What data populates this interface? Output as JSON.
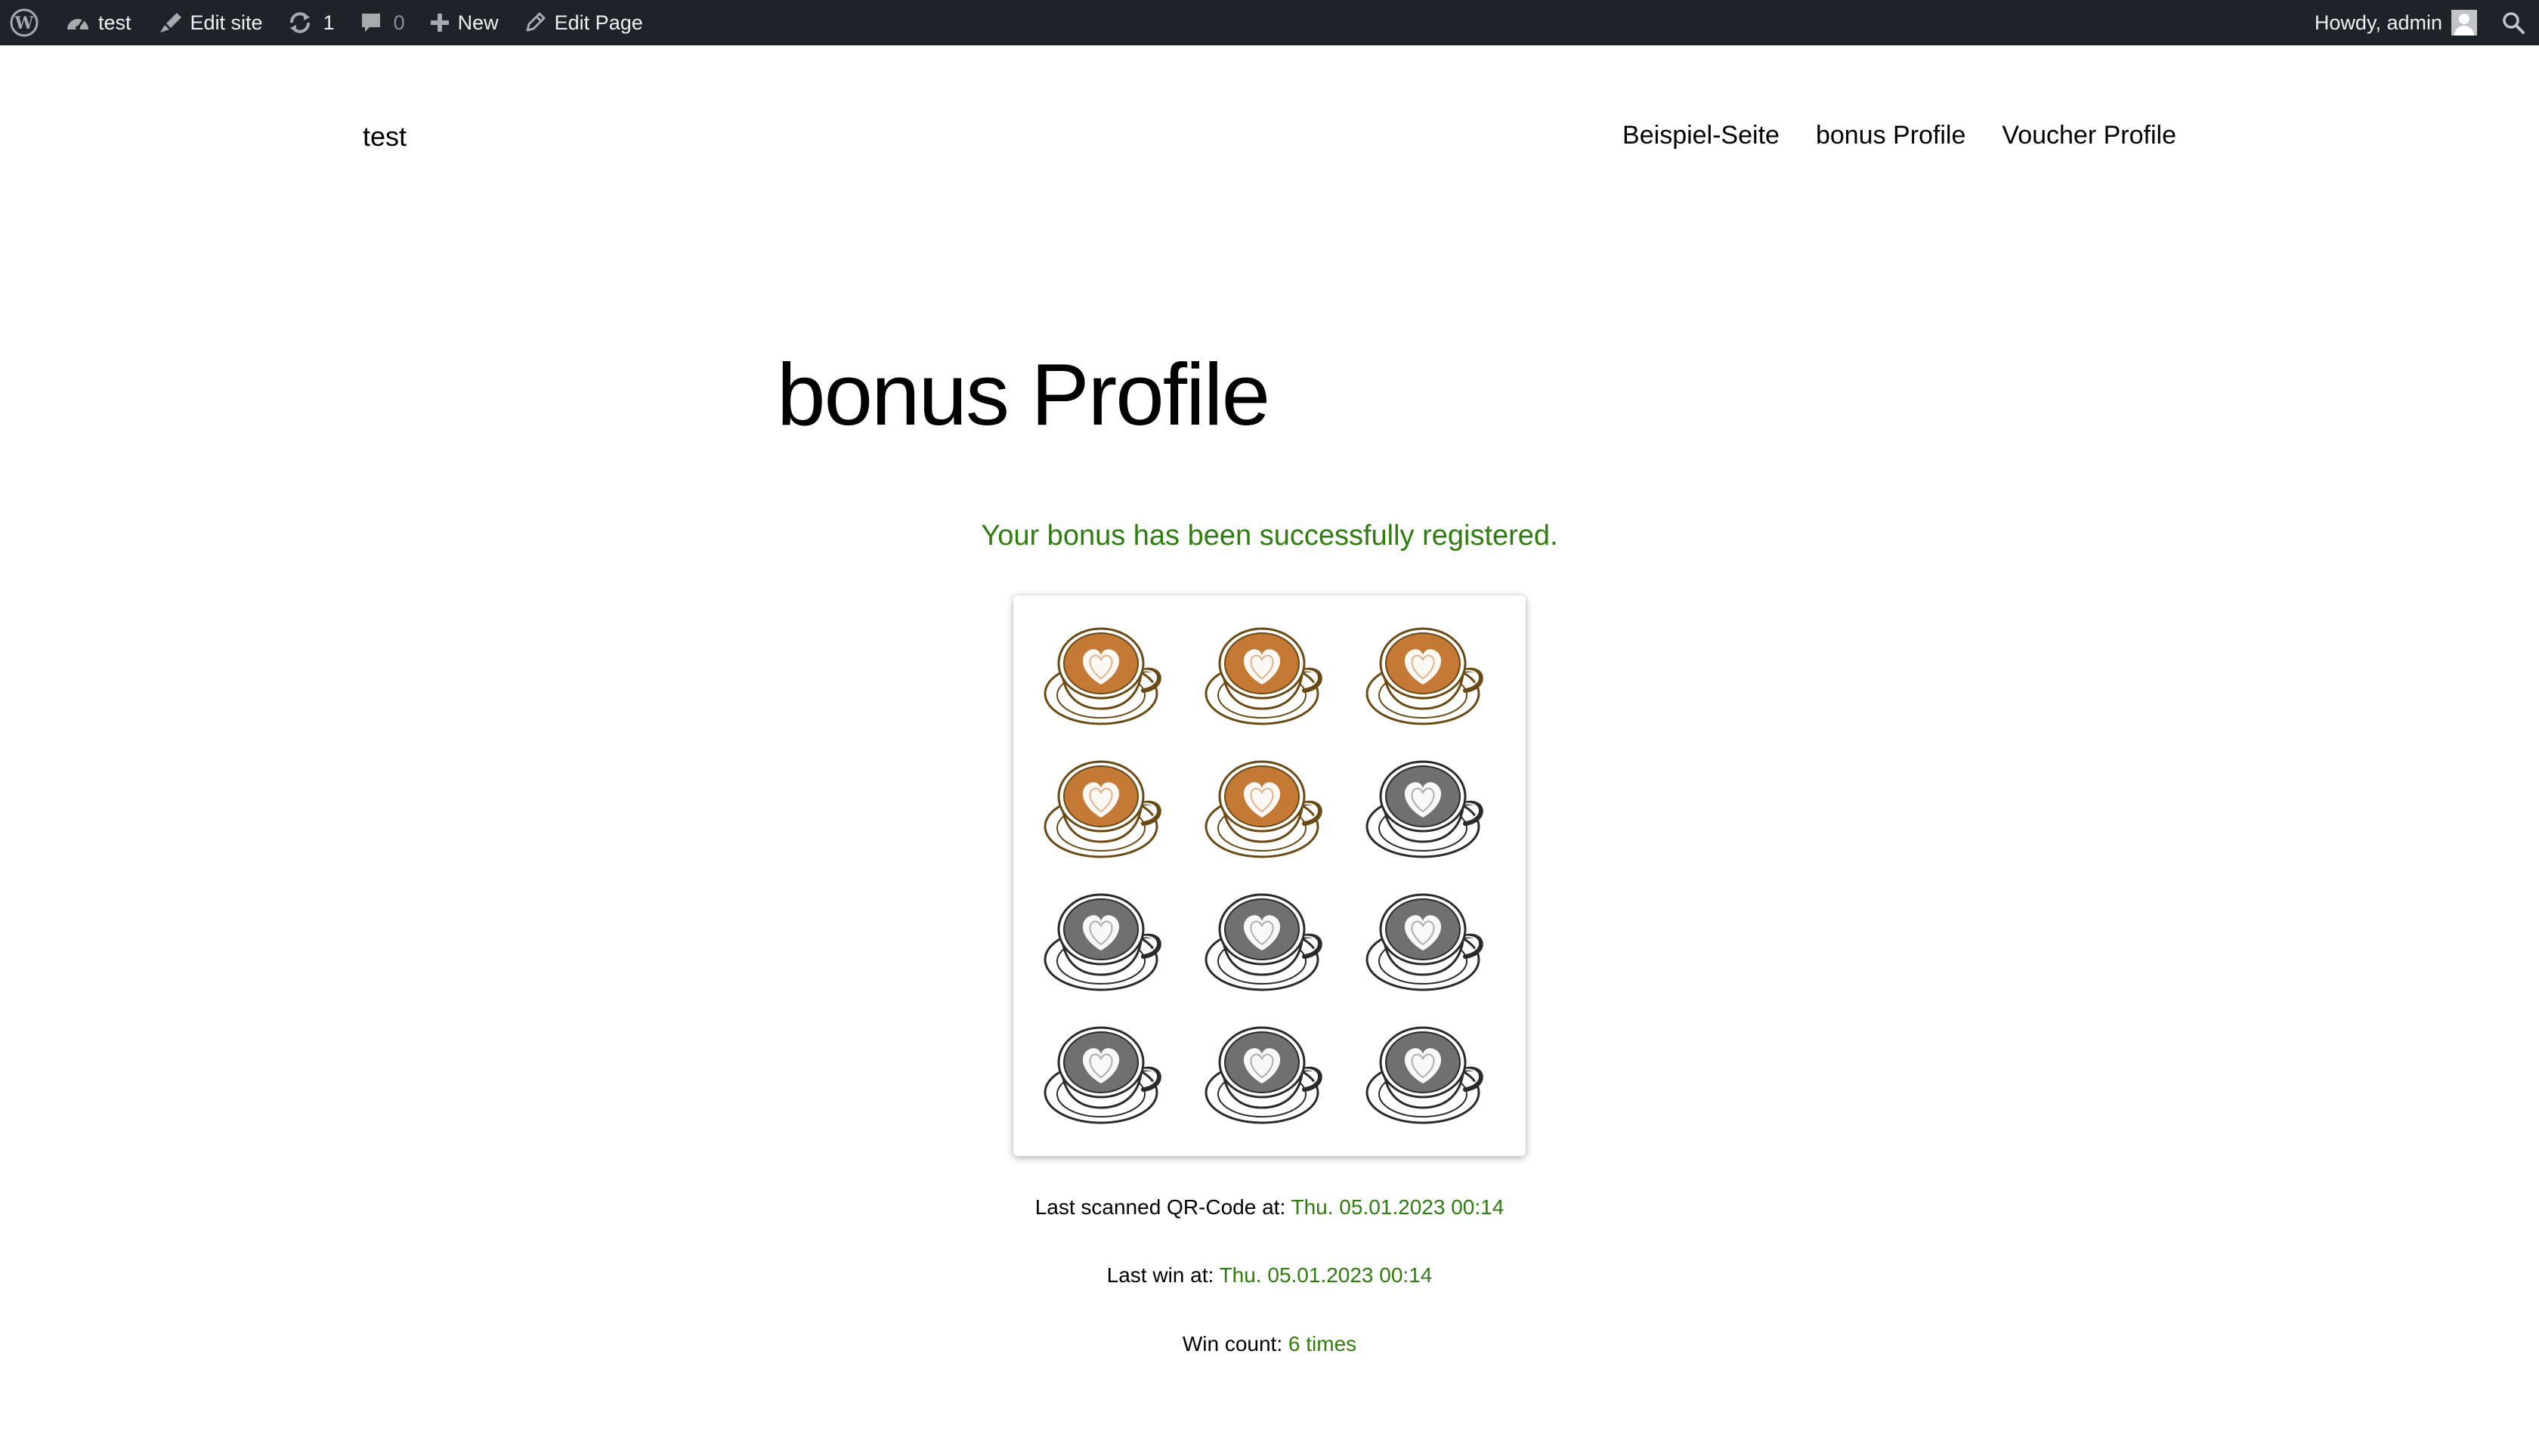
{
  "adminbar": {
    "site_name": "test",
    "edit_site": "Edit site",
    "updates_count": "1",
    "comments_count": "0",
    "new_label": "New",
    "edit_page": "Edit Page",
    "howdy": "Howdy, admin"
  },
  "header": {
    "site_title": "test",
    "nav": [
      "Beispiel-Seite",
      "bonus Profile",
      "Voucher Profile"
    ]
  },
  "page": {
    "title": "bonus Profile",
    "success_message": "Your bonus has been successfully registered.",
    "bonus_card": {
      "total_cups": 12,
      "filled_cups": 5,
      "filled_color": "#c47a35",
      "empty_color": "#707070"
    },
    "last_scanned_label": "Last scanned QR-Code at:",
    "last_scanned_value": "Thu. 05.01.2023 00:14",
    "last_win_label": "Last win at:",
    "last_win_value": "Thu. 05.01.2023 00:14",
    "win_count_label": "Win count:",
    "win_count_value": "6 times"
  },
  "colors": {
    "adminbar_bg": "#1d2327",
    "success_green": "#2e7d0e"
  }
}
